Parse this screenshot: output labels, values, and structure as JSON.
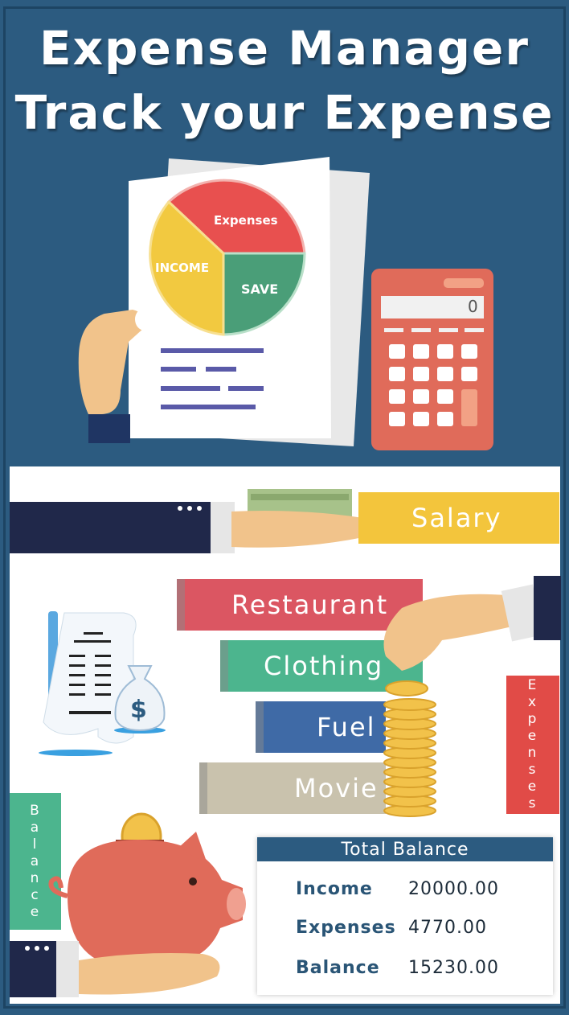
{
  "header": {
    "line1": "Expense Manager",
    "line2": "Track your Expense"
  },
  "pie": {
    "expenses_label": "Expenses",
    "income_label": "INCOME",
    "save_label": "SAVE"
  },
  "calculator": {
    "display": "0"
  },
  "categories": {
    "salary": "Salary",
    "restaurant": "Restaurant",
    "clothing": "Clothing",
    "fuel": "Fuel",
    "movie": "Movie"
  },
  "side_labels": {
    "expenses": [
      "E",
      "x",
      "p",
      "e",
      "n",
      "s",
      "e",
      "s"
    ],
    "balance": [
      "B",
      "a",
      "l",
      "a",
      "n",
      "c",
      "e"
    ]
  },
  "total_balance": {
    "title": "Total Balance",
    "rows": [
      {
        "label": "Income",
        "value": "20000.00"
      },
      {
        "label": "Expenses",
        "value": "4770.00"
      },
      {
        "label": "Balance",
        "value": "15230.00"
      }
    ]
  },
  "colors": {
    "background": "#2c5b80",
    "salary": "#f3c53c",
    "restaurant": "#db5662",
    "clothing": "#4cb58e",
    "fuel": "#3f6aa6",
    "movie": "#c9c2ad",
    "expenses_tag": "#e14b47",
    "balance_tag": "#4cb58e"
  }
}
